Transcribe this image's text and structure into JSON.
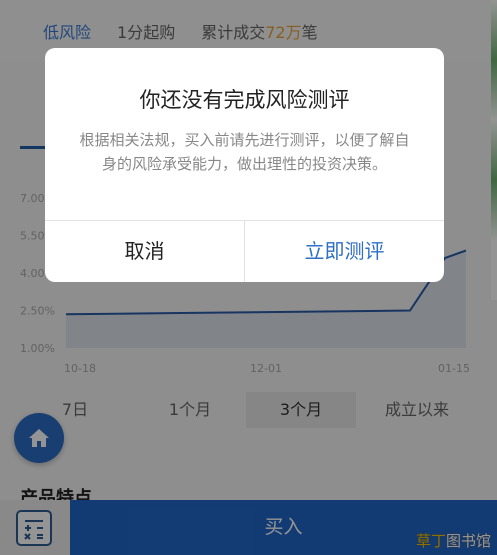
{
  "header": {
    "risk_label": "低风险",
    "min_buy": "1分起购",
    "deals_prefix": "累计成交",
    "deals_count": "72万",
    "deals_suffix": "笔"
  },
  "chart_data": {
    "type": "line",
    "ytick_labels": [
      "7.00%",
      "5.50%",
      "4.00%",
      "2.50%",
      "1.00%"
    ],
    "xtick_labels": [
      "10-18",
      "12-01",
      "01-15"
    ],
    "x": [
      "10-18",
      "12-01",
      "01-15"
    ],
    "series": [
      {
        "values": [
          2.35,
          2.4,
          2.45,
          2.5,
          4.6,
          4.9
        ]
      }
    ],
    "ylim": [
      1.0,
      7.0
    ],
    "line_color": "#2a5aa8"
  },
  "periods": [
    "7日",
    "1个月",
    "3个月",
    "成立以来"
  ],
  "active_period": "3个月",
  "section": {
    "title": "产品特点"
  },
  "bottom": {
    "buy_label": "买入"
  },
  "dialog": {
    "title": "你还没有完成风险测评",
    "message": "根据相关法规，买入前请先进行测评，以便了解自身的风险承受能力，做出理性的投资决策。",
    "cancel_label": "取消",
    "confirm_label": "立即测评"
  },
  "watermark": {
    "part1": "草丁",
    "part2": "图书馆"
  },
  "colors": {
    "accent": "#2067c9",
    "highlight": "#e8a23a"
  },
  "icons": {
    "home": "home-icon",
    "calculator": "calculator-icon"
  }
}
